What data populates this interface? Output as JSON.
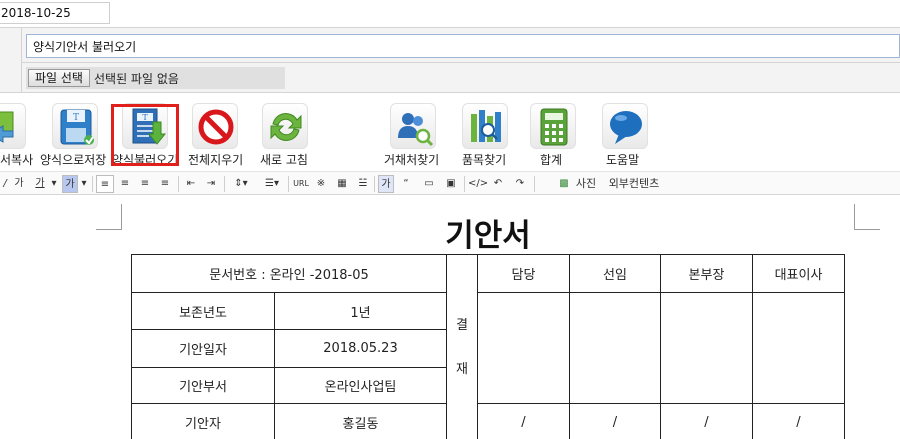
{
  "form": {
    "date_value": "2018-10-25",
    "title_value": "양식기안서 불러오기",
    "file_button": "파일 선택",
    "file_status": "선택된 파일 없음"
  },
  "toolbar": {
    "buttons": [
      {
        "label": "서복사",
        "icon": "copy-icon"
      },
      {
        "label": "양식으로저장",
        "icon": "floppy-disk-icon"
      },
      {
        "label": "양식불러오기",
        "icon": "load-template-icon"
      },
      {
        "label": "전체지우기",
        "icon": "no-sign-icon"
      },
      {
        "label": "새로 고침",
        "icon": "refresh-icon"
      },
      {
        "label": "거채처찾기",
        "icon": "people-search-icon"
      },
      {
        "label": "품목찾기",
        "icon": "item-search-icon"
      },
      {
        "label": "합계",
        "icon": "calculator-icon"
      },
      {
        "label": "도움말",
        "icon": "speech-bubble-icon"
      }
    ],
    "highlighted": "양식불러오기"
  },
  "editor_bar": {
    "url_label": "URL",
    "photo_label": "사진",
    "external_label": "외부컨텐츠",
    "font_label": "가"
  },
  "document": {
    "title": "기안서",
    "doc_number": "문서번호 : 온라인 -2018-05",
    "approval_label_top": "결",
    "approval_label_bottom": "재",
    "approver_headers": [
      "담당",
      "선임",
      "본부장",
      "대표이사"
    ],
    "approver_slash": "/",
    "rows": [
      {
        "label": "보존년도",
        "value": "1년"
      },
      {
        "label": "기안일자",
        "value": "2018.05.23"
      },
      {
        "label": "기안부서",
        "value": "온라인사업팀"
      },
      {
        "label": "기안자",
        "value": "홍길동"
      }
    ]
  },
  "colors": {
    "highlight": "#e0201b",
    "input_border": "#9fb6d6"
  }
}
